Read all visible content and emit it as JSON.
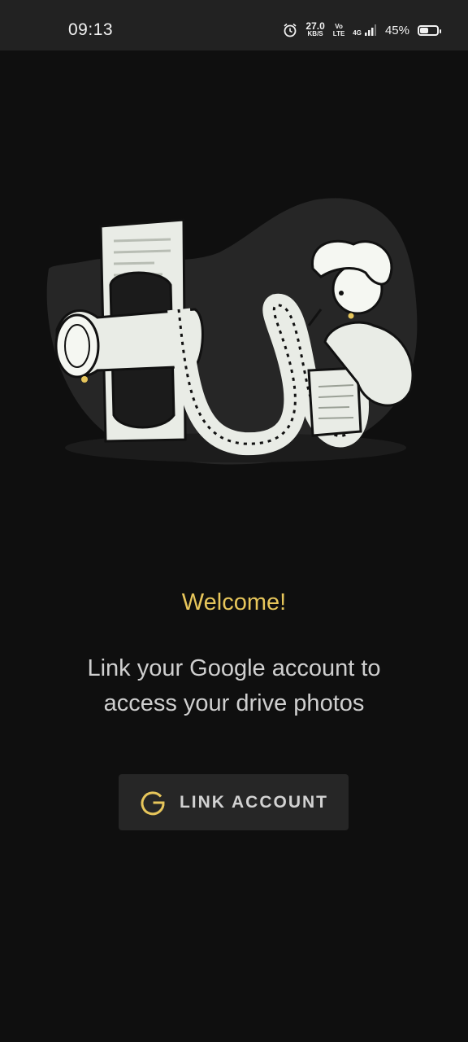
{
  "status_bar": {
    "time": "09:13",
    "net_speed_value": "27.0",
    "net_speed_unit": "KB/S",
    "volte_top": "Vo",
    "volte_bottom": "LTE",
    "network_type": "4G",
    "battery_percent": "45%",
    "battery_level": 0.45,
    "icons": [
      "alarm-icon",
      "signal-icon",
      "battery-icon"
    ]
  },
  "illustration": {
    "icon": "film-reel-illustration"
  },
  "main": {
    "title": "Welcome!",
    "subtitle": "Link your Google account to access your drive photos",
    "button_label": "LINK ACCOUNT",
    "button_icon": "google-g-icon"
  },
  "colors": {
    "background": "#0f0f0f",
    "accent": "#e7c65b",
    "button_bg": "#262626",
    "status_bar": "#222222"
  }
}
